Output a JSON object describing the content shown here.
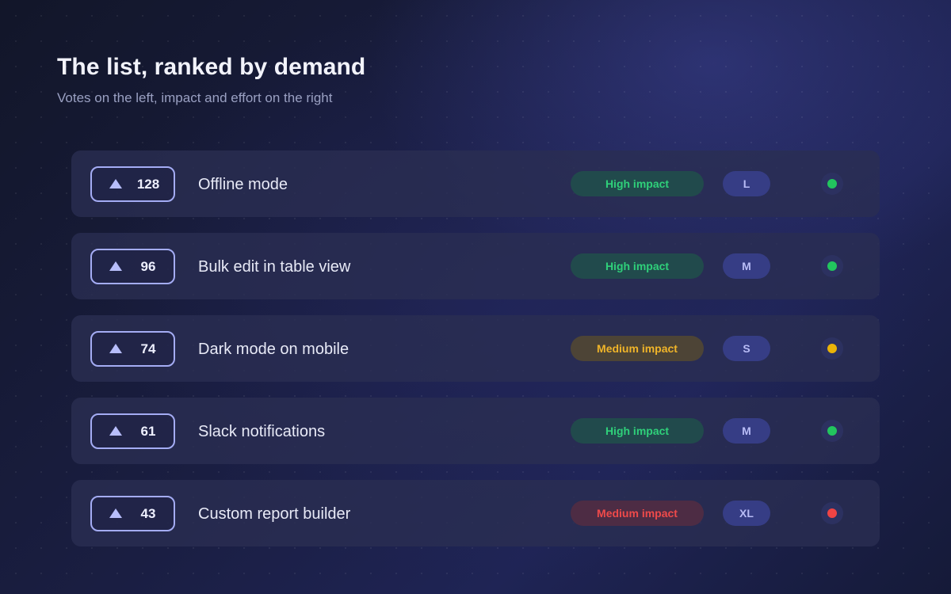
{
  "header": {
    "title": "The list, ranked by demand",
    "subtitle": "Votes on the left, impact and effort on the right"
  },
  "colors": {
    "green": "#2fd07a",
    "yellow": "#f0b429",
    "red": "#ef4a4a",
    "vote_border": "#a4acf4"
  },
  "items": [
    {
      "votes": "128",
      "title": "Offline mode",
      "impact": "High impact",
      "impact_color": "green",
      "effort": "L",
      "status_color": "#22c55e"
    },
    {
      "votes": "96",
      "title": "Bulk edit in table view",
      "impact": "High impact",
      "impact_color": "green",
      "effort": "M",
      "status_color": "#22c55e"
    },
    {
      "votes": "74",
      "title": "Dark mode on mobile",
      "impact": "Medium impact",
      "impact_color": "yellow",
      "effort": "S",
      "status_color": "#eab308"
    },
    {
      "votes": "61",
      "title": "Slack notifications",
      "impact": "High impact",
      "impact_color": "green",
      "effort": "M",
      "status_color": "#22c55e"
    },
    {
      "votes": "43",
      "title": "Custom report builder",
      "impact": "Medium impact",
      "impact_color": "red",
      "effort": "XL",
      "status_color": "#ef4444"
    }
  ]
}
